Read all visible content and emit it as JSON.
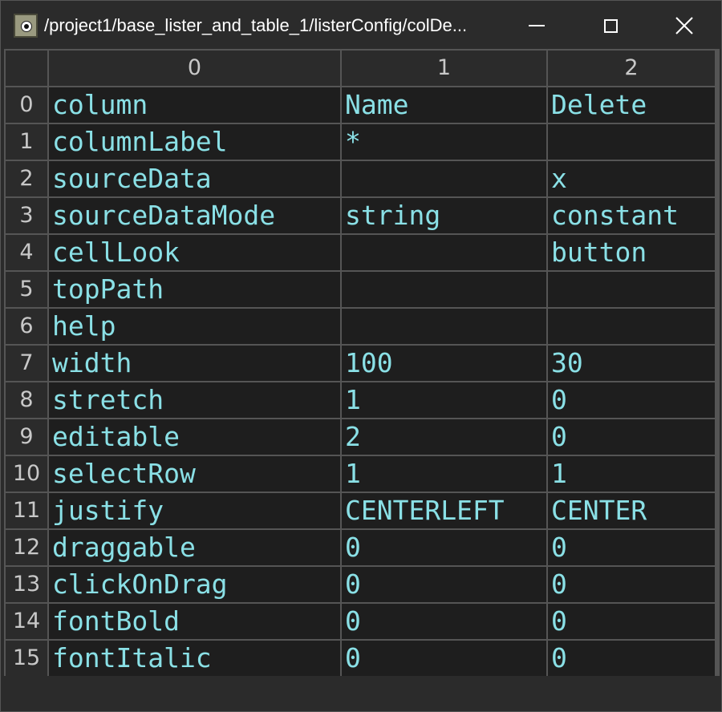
{
  "window": {
    "title": "/project1/base_lister_and_table_1/listerConfig/colDe...",
    "icon": "table-dat-icon"
  },
  "table": {
    "columns": [
      "0",
      "1",
      "2"
    ],
    "rows": [
      {
        "index": "0",
        "cells": [
          "column",
          "Name",
          "Delete"
        ]
      },
      {
        "index": "1",
        "cells": [
          "columnLabel",
          "*",
          ""
        ]
      },
      {
        "index": "2",
        "cells": [
          "sourceData",
          "",
          "x"
        ]
      },
      {
        "index": "3",
        "cells": [
          "sourceDataMode",
          "string",
          "constant"
        ]
      },
      {
        "index": "4",
        "cells": [
          "cellLook",
          "",
          "button"
        ]
      },
      {
        "index": "5",
        "cells": [
          "topPath",
          "",
          ""
        ]
      },
      {
        "index": "6",
        "cells": [
          "help",
          "",
          ""
        ]
      },
      {
        "index": "7",
        "cells": [
          "width",
          "100",
          "30"
        ]
      },
      {
        "index": "8",
        "cells": [
          "stretch",
          "1",
          "0"
        ]
      },
      {
        "index": "9",
        "cells": [
          "editable",
          "2",
          "0"
        ]
      },
      {
        "index": "10",
        "cells": [
          "selectRow",
          "1",
          "1"
        ]
      },
      {
        "index": "11",
        "cells": [
          "justify",
          "CENTERLEFT",
          "CENTER"
        ]
      },
      {
        "index": "12",
        "cells": [
          "draggable",
          "0",
          "0"
        ]
      },
      {
        "index": "13",
        "cells": [
          "clickOnDrag",
          "0",
          "0"
        ]
      },
      {
        "index": "14",
        "cells": [
          "fontBold",
          "0",
          "0"
        ]
      },
      {
        "index": "15",
        "cells": [
          "fontItalic",
          "0",
          "0"
        ]
      }
    ]
  },
  "colors": {
    "cell_text": "#8ae0e6",
    "cell_bg": "#1e1e1e",
    "header_text": "#c8c8c8",
    "gridline": "#555555"
  }
}
